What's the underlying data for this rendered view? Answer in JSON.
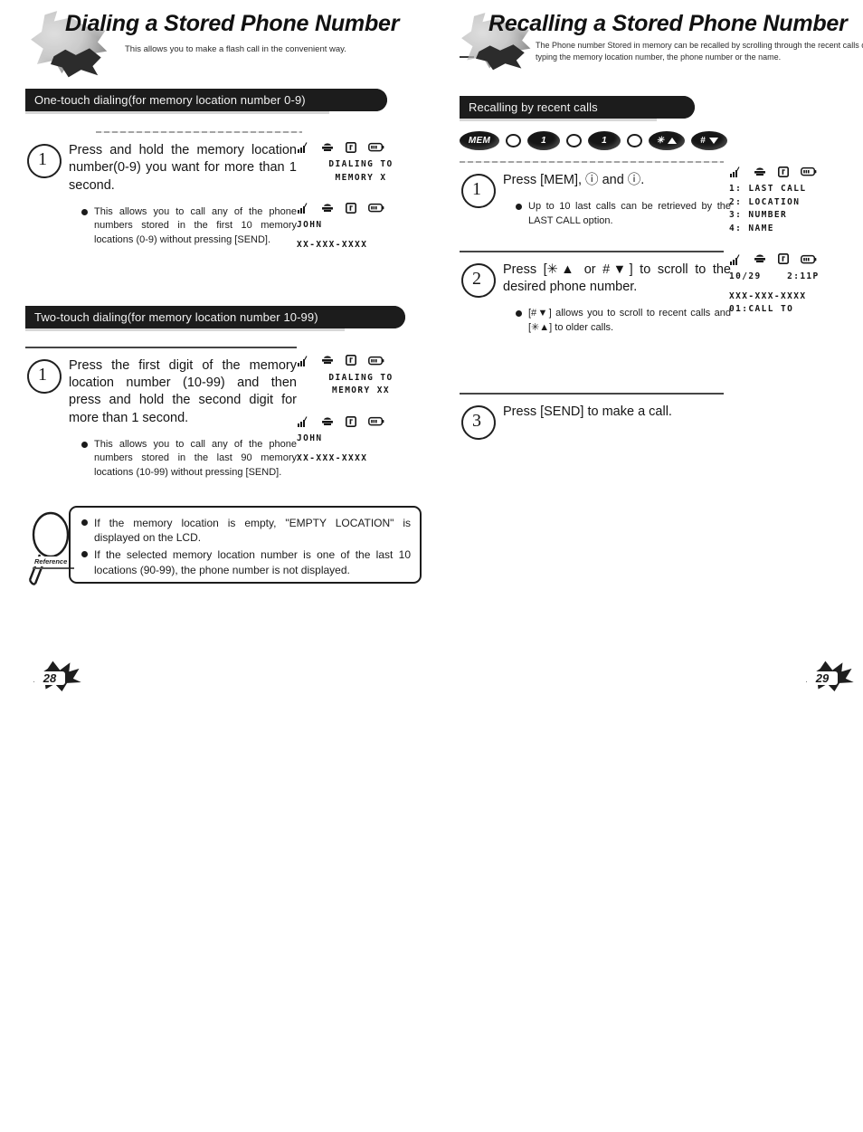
{
  "left_page": {
    "heading": "Dialing a Stored Phone Number",
    "subtitle": "This allows you to make a flash call in the convenient way.",
    "page_number": "28",
    "sections": [
      {
        "bar_label": "One-touch dialing(for memory location number 0-9)",
        "step_number": "1",
        "step_text": "Press and hold the memory location number(0-9) you want for more than 1 second.",
        "bullets": [
          "This allows you to call any of the phone numbers stored in the first 10 memory locations (0-9) without pressing [SEND]."
        ],
        "lcds": [
          {
            "status_icons": [
              "signal-icon",
              "roam-icon",
              "letter-icon",
              "battery-icon"
            ],
            "lines": [
              "DIALING TO",
              "MEMORY X"
            ],
            "align": "center"
          },
          {
            "status_icons": [
              "signal-icon",
              "roam-icon",
              "letter-icon",
              "battery-icon"
            ],
            "lines": [
              "JOHN",
              "",
              "XX-XXX-XXXX"
            ],
            "align": "left"
          }
        ]
      },
      {
        "bar_label": "Two-touch dialing(for memory location number 10-99)",
        "step_number": "1",
        "step_text": "Press the first digit of the memory location number (10-99) and then press and hold the second digit for more than 1 second.",
        "bullets": [
          "This allows you to call any of the phone numbers stored in the last 90 memory locations (10-99) without pressing [SEND]."
        ],
        "lcds": [
          {
            "status_icons": [
              "signal-icon",
              "roam-icon",
              "letter-icon",
              "battery-icon"
            ],
            "lines": [
              "DIALING TO",
              "MEMORY XX"
            ],
            "align": "center"
          },
          {
            "status_icons": [
              "signal-icon",
              "roam-icon",
              "letter-icon",
              "battery-icon"
            ],
            "lines": [
              "JOHN",
              "",
              "XX-XXX-XXXX"
            ],
            "align": "left"
          }
        ]
      }
    ],
    "reference_note": {
      "icon": "magnifier-icon",
      "label": "Reference",
      "bullets": [
        "If the memory location is empty, \"EMPTY LOCATION\" is displayed on the LCD.",
        "If the selected memory location number is one of the last 10 locations (90-99), the phone number is not displayed."
      ]
    }
  },
  "right_page": {
    "heading": "Recalling a Stored Phone Number",
    "subtitle": "The Phone number Stored in memory can be recalled by scrolling through the recent calls or typing the memory location number, the phone number or the name.",
    "page_number": "29",
    "bar_label": "Recalling by recent calls",
    "key_sequence": [
      {
        "type": "pill",
        "label": "MEM"
      },
      {
        "type": "oval"
      },
      {
        "type": "pill",
        "label": "1"
      },
      {
        "type": "oval"
      },
      {
        "type": "pill",
        "label": "1"
      },
      {
        "type": "oval"
      },
      {
        "type": "pill-star-up",
        "label": "✳"
      },
      {
        "type": "pill-hash-down",
        "label": "#"
      }
    ],
    "steps": [
      {
        "step_number": "1",
        "step_text": "Press [MEM], ⓘ and ⓘ.",
        "bullets": [
          "Up to 10 last calls can be retrieved by the LAST CALL option."
        ]
      },
      {
        "step_number": "2",
        "step_text": "Press [✳▲ or #▼] to scroll to the desired phone number.",
        "bullets": [
          "[#▼] allows you to scroll to recent calls and [✳▲] to older calls."
        ]
      },
      {
        "step_number": "3",
        "step_text": "Press [SEND] to make a call.",
        "bullets": []
      }
    ],
    "lcds": [
      {
        "status_icons": [
          "signal-icon",
          "roam-icon",
          "letter-icon",
          "battery-icon"
        ],
        "lines": [
          "1: LAST CALL",
          "2: LOCATION",
          "3: NUMBER",
          "4: NAME"
        ],
        "align": "left"
      },
      {
        "status_icons": [
          "signal-icon",
          "roam-icon",
          "letter-icon",
          "battery-icon"
        ],
        "lines": [
          "10/29    2:11P",
          "",
          "XXX-XXX-XXXX",
          "01:CALL TO"
        ],
        "align": "left"
      }
    ]
  }
}
